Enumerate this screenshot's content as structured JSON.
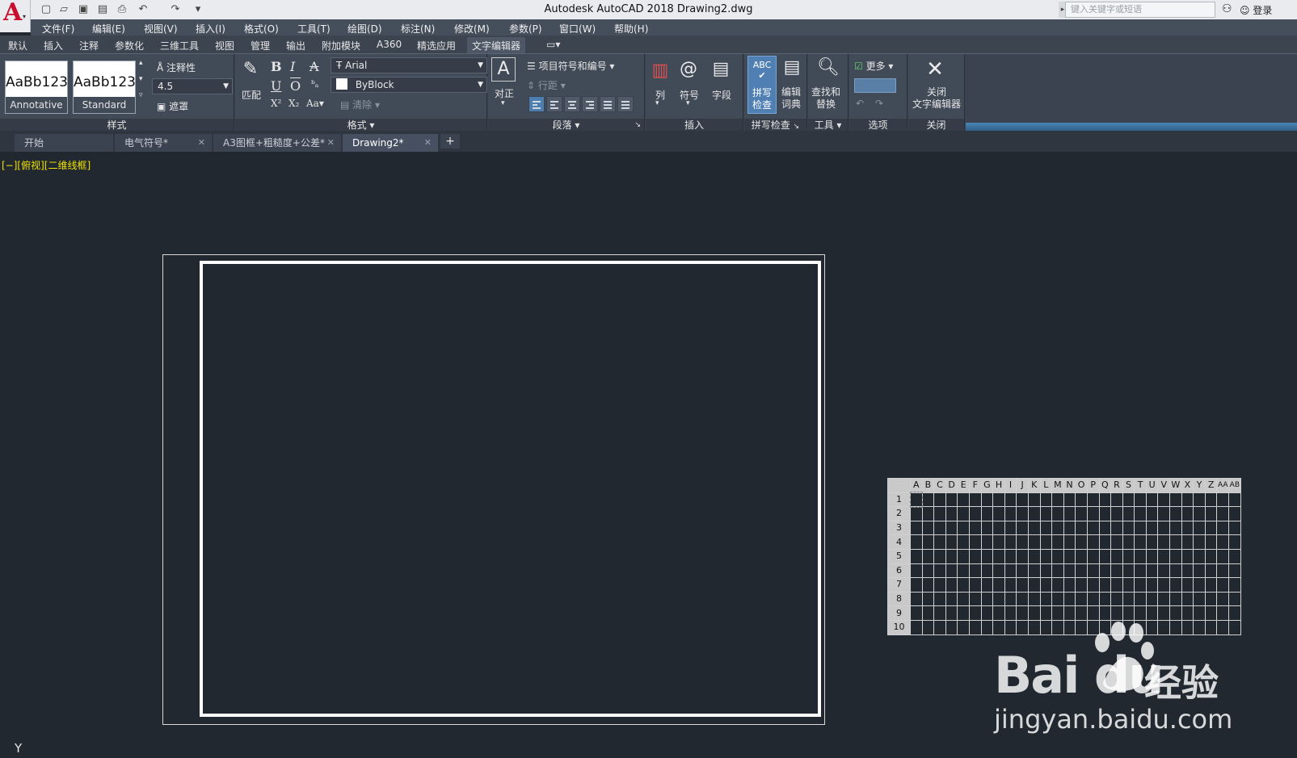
{
  "titlebar": {
    "title": "Autodesk AutoCAD 2018    Drawing2.dwg",
    "search_placeholder": "键入关键字或短语",
    "login": "登录"
  },
  "menubar": [
    "文件(F)",
    "编辑(E)",
    "视图(V)",
    "插入(I)",
    "格式(O)",
    "工具(T)",
    "绘图(D)",
    "标注(N)",
    "修改(M)",
    "参数(P)",
    "窗口(W)",
    "帮助(H)"
  ],
  "ribbon_tabs": [
    "默认",
    "插入",
    "注释",
    "参数化",
    "三维工具",
    "视图",
    "管理",
    "输出",
    "附加模块",
    "A360",
    "精选应用",
    "文字编辑器"
  ],
  "ribbon": {
    "style_panel": {
      "swatch1_sample": "AaBb123",
      "swatch1_name": "Annotative",
      "swatch2_sample": "AaBb123",
      "swatch2_name": "Standard",
      "annotative": "注释性",
      "height": "4.5",
      "mask": "遮罩",
      "label": "样式"
    },
    "format_panel": {
      "match": "匹配",
      "font": "Arial",
      "color": "ByBlock",
      "clear": "清除",
      "label": "格式"
    },
    "paragraph_panel": {
      "justify": "对正",
      "bullets": "项目符号和编号",
      "line_spacing": "行距",
      "label": "段落"
    },
    "insert_panel": {
      "columns": "列",
      "symbol": "符号",
      "field": "字段",
      "label": "插入"
    },
    "spell_panel": {
      "spell_check_1": "拼写",
      "spell_check_2": "检查",
      "dict_1": "编辑",
      "dict_2": "词典",
      "label": "拼写检查"
    },
    "tools_panel": {
      "find_1": "查找和",
      "find_2": "替换",
      "label": "工具"
    },
    "options_panel": {
      "more": "更多",
      "label": "选项"
    },
    "close_panel": {
      "close_1": "关闭",
      "close_2": "文字编辑器",
      "label": "关闭"
    }
  },
  "file_tabs": [
    {
      "label": "开始"
    },
    {
      "label": "电气符号*"
    },
    {
      "label": "A3图框+粗糙度+公差*"
    },
    {
      "label": "Drawing2*"
    }
  ],
  "viewport_label": "[−][俯视][二维线框]",
  "ucs_label": "Y",
  "grid": {
    "columns": [
      "A",
      "B",
      "C",
      "D",
      "E",
      "F",
      "G",
      "H",
      "I",
      "J",
      "K",
      "L",
      "M",
      "N",
      "O",
      "P",
      "Q",
      "R",
      "S",
      "T",
      "U",
      "V",
      "W",
      "X",
      "Y",
      "Z",
      "AA",
      "AB"
    ],
    "rows": [
      "1",
      "2",
      "3",
      "4",
      "5",
      "6",
      "7",
      "8",
      "9",
      "10"
    ]
  },
  "watermark": {
    "logo": "Bai du",
    "cn": "经验",
    "url": "jingyan.baidu.com"
  }
}
